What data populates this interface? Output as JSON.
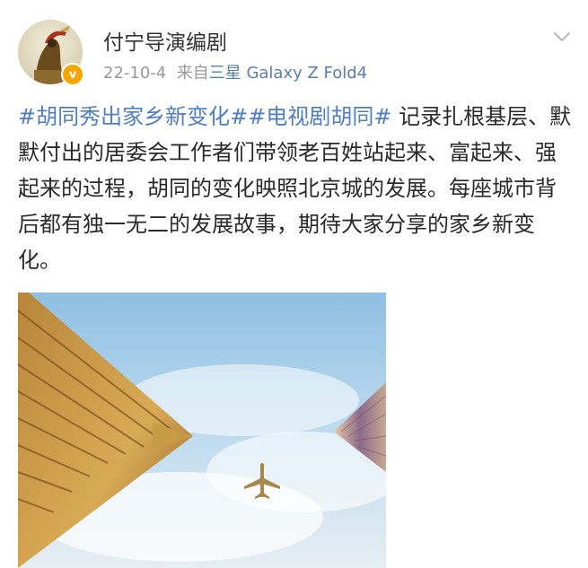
{
  "author": {
    "name": "付宁导演编剧",
    "verified_badge": "v"
  },
  "meta": {
    "date": "22-10-4",
    "source_prefix": "来自",
    "device": "三星 Galaxy Z Fold4"
  },
  "post": {
    "hashtag_1": "#胡同秀出家乡新变化#",
    "hashtag_2": "#电视剧胡同#",
    "body": " 记录扎根基层、默默付出的居委会工作者们带领老百姓站起来、富起来、强起来的过程，胡同的变化映照北京城的发展。每座城市背后都有独一无二的发展故事，期待大家分享的家乡新变化。"
  },
  "icons": {
    "chevron": "chevron-down-icon",
    "avatar": "avatar-image",
    "plane": "airplane-icon"
  },
  "colors": {
    "hashtag": "#4f7ec4",
    "device_link": "#5a7eb0",
    "badge": "#f7a600",
    "meta_gray": "#999999"
  }
}
